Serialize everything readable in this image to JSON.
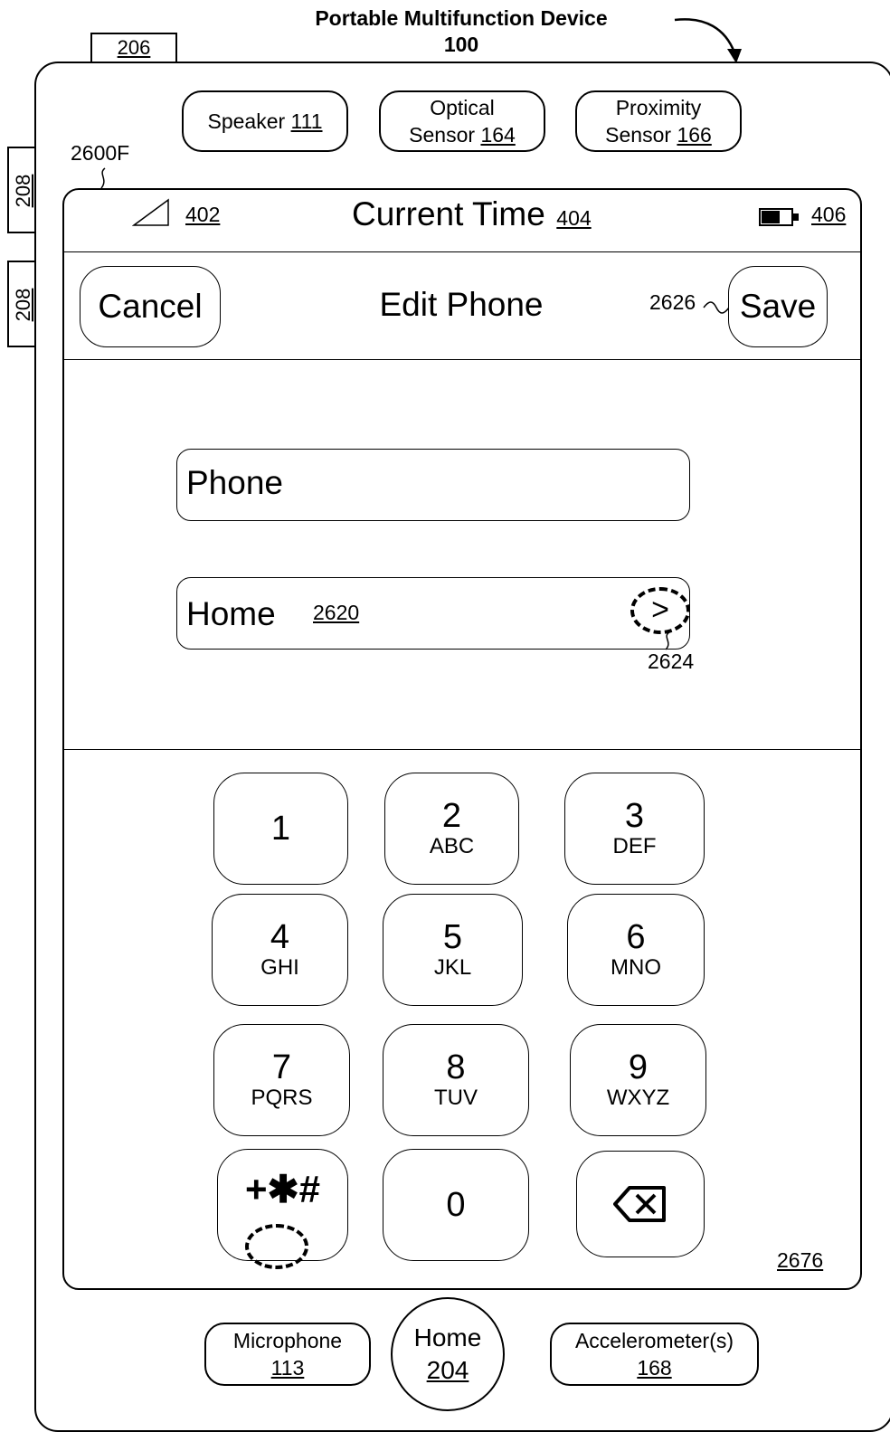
{
  "header": {
    "title": "Portable Multifunction Device",
    "number": "100"
  },
  "refs": {
    "tab_top": "206",
    "side_1": "208",
    "side_2": "208",
    "screen_ref": "2600F"
  },
  "sensors": [
    {
      "line1": "Speaker",
      "ref": "111"
    },
    {
      "line1": "Optical",
      "line2": "Sensor",
      "ref": "164"
    },
    {
      "line1": "Proximity",
      "line2": "Sensor",
      "ref": "166"
    }
  ],
  "status_bar": {
    "signal_ref": "402",
    "time_label": "Current Time",
    "time_ref": "404",
    "battery_ref": "406"
  },
  "nav": {
    "cancel_label": "Cancel",
    "title": "Edit Phone",
    "save_label": "Save",
    "save_ref": "2626"
  },
  "form": {
    "phone_field_value": "Phone",
    "type_field_label": "Home",
    "type_field_ref": "2620",
    "disclosure_symbol": ">",
    "disclosure_ref": "2624"
  },
  "keypad": {
    "keys": [
      {
        "digit": "1",
        "letters": ""
      },
      {
        "digit": "2",
        "letters": "ABC"
      },
      {
        "digit": "3",
        "letters": "DEF"
      },
      {
        "digit": "4",
        "letters": "GHI"
      },
      {
        "digit": "5",
        "letters": "JKL"
      },
      {
        "digit": "6",
        "letters": "MNO"
      },
      {
        "digit": "7",
        "letters": "PQRS"
      },
      {
        "digit": "8",
        "letters": "TUV"
      },
      {
        "digit": "9",
        "letters": "WXYZ"
      },
      {
        "digit": "+✱#",
        "letters": ""
      },
      {
        "digit": "0",
        "letters": ""
      },
      {
        "digit": "",
        "letters": ""
      }
    ],
    "keypad_ref": "2676"
  },
  "bottom": {
    "microphone_label": "Microphone",
    "microphone_ref": "113",
    "home_label": "Home",
    "home_ref": "204",
    "accel_label": "Accelerometer(s)",
    "accel_ref": "168"
  },
  "icons": [
    "signal-icon",
    "battery-icon",
    "backspace-icon",
    "disclosure-icon",
    "arrow-icon"
  ]
}
